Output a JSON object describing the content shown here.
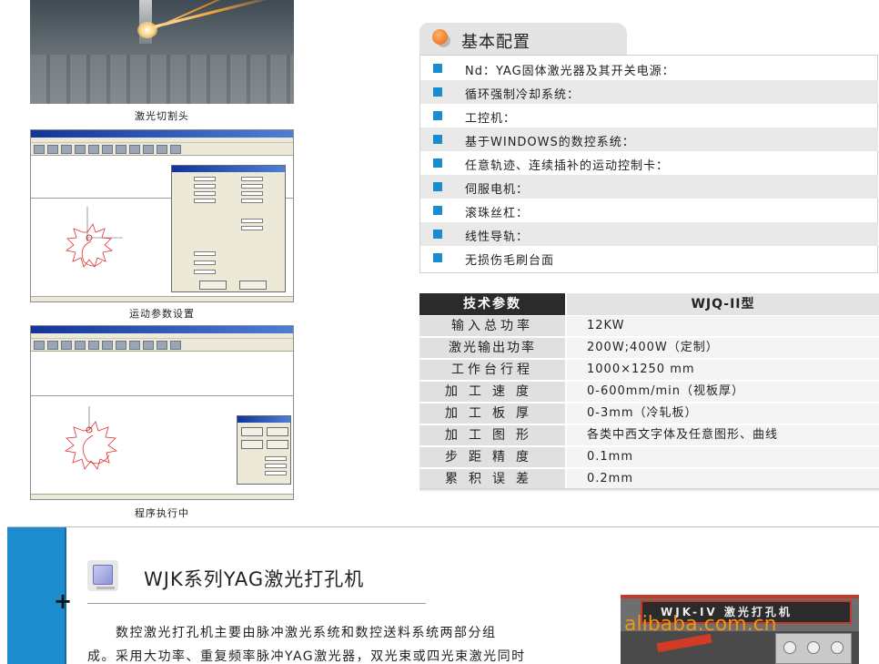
{
  "left_column": {
    "photo_caption": "激光切割头",
    "screen1_caption": "运动参数设置",
    "screen2_caption": "程序执行中"
  },
  "basic_config": {
    "title": "基本配置",
    "items": [
      "Nd：YAG固体激光器及其开关电源：",
      "循环强制冷却系统：",
      "工控机：",
      "基于WINDOWS的数控系统：",
      "任意轨迹、连续插补的运动控制卡：",
      "伺服电机：",
      "滚珠丝杠：",
      "线性导轨：",
      "无损伤毛刷台面"
    ]
  },
  "tech_params": {
    "header_key": "技术参数",
    "header_value": "WJQ-II型",
    "rows": [
      {
        "k": "输入总功率",
        "v": "12KW"
      },
      {
        "k": "激光输出功率",
        "v": "200W;400W（定制）"
      },
      {
        "k": "工作台行程",
        "v": "1000×1250 mm"
      },
      {
        "k": "加工速度",
        "v": "0-600mm/min（视板厚）"
      },
      {
        "k": "加工板厚",
        "v": "0-3mm（冷轧板）"
      },
      {
        "k": "加工图形",
        "v": "各类中西文字体及任意图形、曲线"
      },
      {
        "k": "步距精度",
        "v": "0.1mm"
      },
      {
        "k": "累积误差",
        "v": "0.2mm"
      }
    ]
  },
  "wjk_section": {
    "title": "WJK系列YAG激光打孔机",
    "plus_symbol": "+",
    "paragraph_lines": [
      "　　数控激光打孔机主要由脉冲激光系统和数控送料系统两部分组",
      "成。采用大功率、重复频率脉冲YAG激光器，双光束或四光束激光同时"
    ],
    "machine_label": "WJK-IV  激光打孔机",
    "watermark": "alibaba.com.cn"
  },
  "colors": {
    "accent_blue": "#1d8ccf",
    "orange_dot": "#e8620c",
    "table_header_dark": "#2b2b2b",
    "watermark_orange": "#f59a13"
  }
}
